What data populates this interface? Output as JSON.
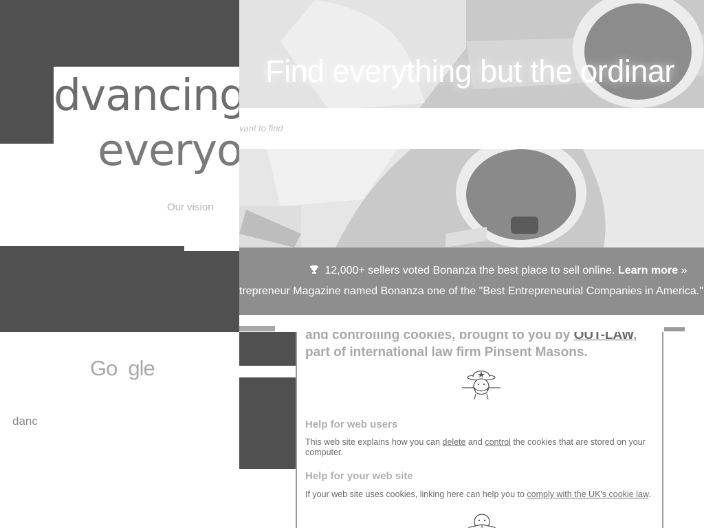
{
  "google": {
    "headline_line1": "dvancing",
    "headline_line2": "everyo",
    "vision_link": "Our vision",
    "logo_left": "Go",
    "logo_right": "gle",
    "small_text": "danc"
  },
  "bonanza": {
    "hero_title": "Find everything but the ordinar",
    "search_placeholder": "vant to find",
    "banner_line1_text": "12,000+ sellers voted Bonanza the best place to sell online.",
    "banner_line1_link": "Learn more",
    "banner_line1_arrow": "»",
    "banner_line2": "trepreneur Magazine named Bonanza one of the \"Best Entrepreneurial Companies in America.\"",
    "icons": [
      "trophy-icon"
    ]
  },
  "cookies": {
    "intro_line1_prefix": "and controlling cookies, brought to you by",
    "intro_link": "OUT-LAW",
    "intro_line1_suffix": ",",
    "intro_line2": "part of international law firm Pinsent Masons.",
    "help_web_users_heading": "Help for web users",
    "help_web_users_p_prefix": "This web site explains how you can",
    "help_web_users_link_delete": "delete",
    "help_web_users_and": "and",
    "help_web_users_link_control": "control",
    "help_web_users_p_suffix": "the cookies that are stored on your computer.",
    "help_web_site_heading": "Help for your web site",
    "help_web_site_p_prefix": "If your web site uses cookies, linking here can help you to",
    "help_web_site_link": "comply with the UK's cookie law",
    "help_web_site_p_suffix": ".",
    "icons": [
      "cowboy-icon",
      "cowboy-reading-icon"
    ]
  }
}
